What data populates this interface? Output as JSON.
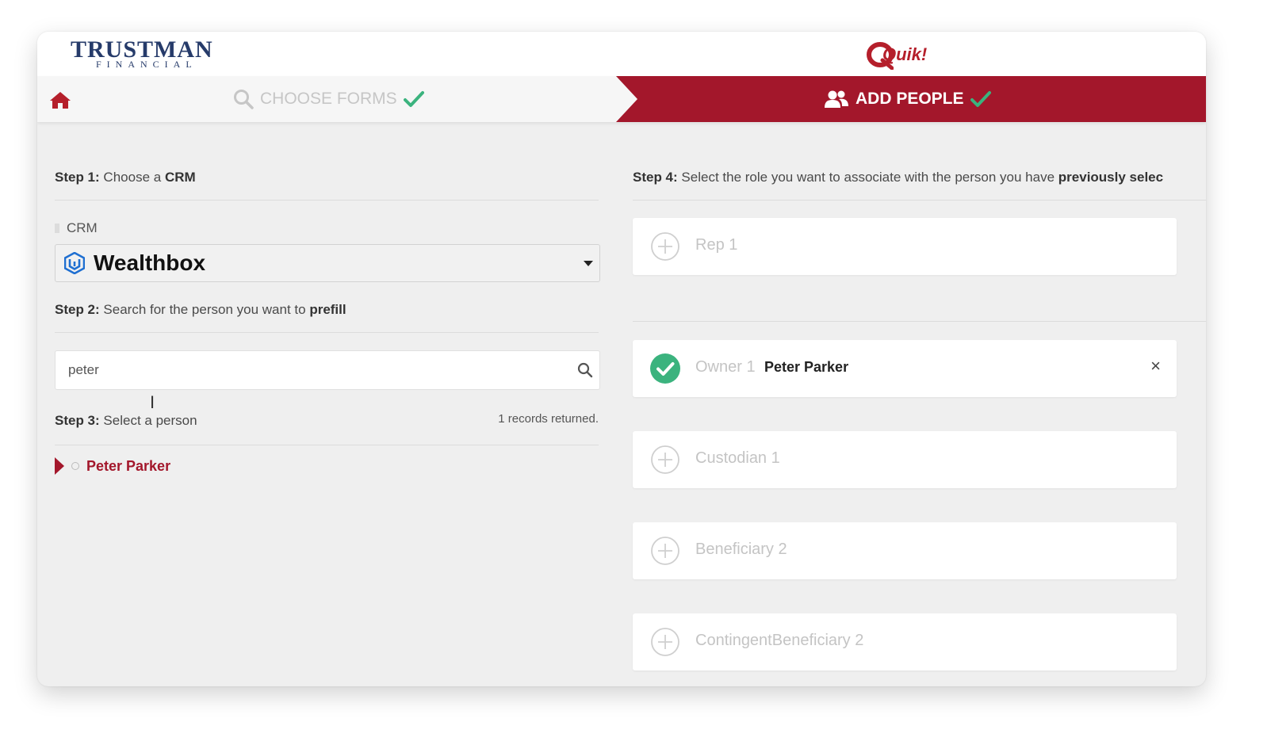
{
  "header": {
    "brand_name": "TRUSTMAN",
    "brand_sub": "FINANCIAL",
    "partner_logo": "Quik!"
  },
  "nav": {
    "home_icon": "home-icon",
    "choose_forms": "CHOOSE FORMS",
    "add_people": "ADD PEOPLE"
  },
  "left": {
    "step1": {
      "prefix": "Step 1:",
      "text": "Choose a",
      "bold": "CRM"
    },
    "crm_label": "CRM",
    "crm_value": "Wealthbox",
    "step2": {
      "prefix": "Step 2:",
      "text": "Search for the person you want to",
      "bold": "prefill"
    },
    "search_value": "peter",
    "step3": {
      "prefix": "Step 3:",
      "text": "Select a person"
    },
    "records": "1 records returned.",
    "results": [
      {
        "name": "Peter Parker"
      }
    ]
  },
  "right": {
    "step4": {
      "prefix": "Step 4:",
      "text": "Select the role you want to associate with the person you have",
      "bold": "previously selec"
    },
    "roles": [
      {
        "name": "Rep 1",
        "assigned": "",
        "selected": false
      },
      {
        "name": "Owner 1",
        "assigned": "Peter Parker",
        "selected": true
      },
      {
        "name": "Custodian 1",
        "assigned": "",
        "selected": false
      },
      {
        "name": "Beneficiary 2",
        "assigned": "",
        "selected": false
      },
      {
        "name": "ContingentBeneficiary 2",
        "assigned": "",
        "selected": false
      }
    ],
    "remove_symbol": "×"
  },
  "colors": {
    "brand_red": "#a3172b",
    "brand_navy": "#263b6a",
    "check_green": "#3bb37e",
    "wealthbox_blue": "#1f6fd1"
  }
}
